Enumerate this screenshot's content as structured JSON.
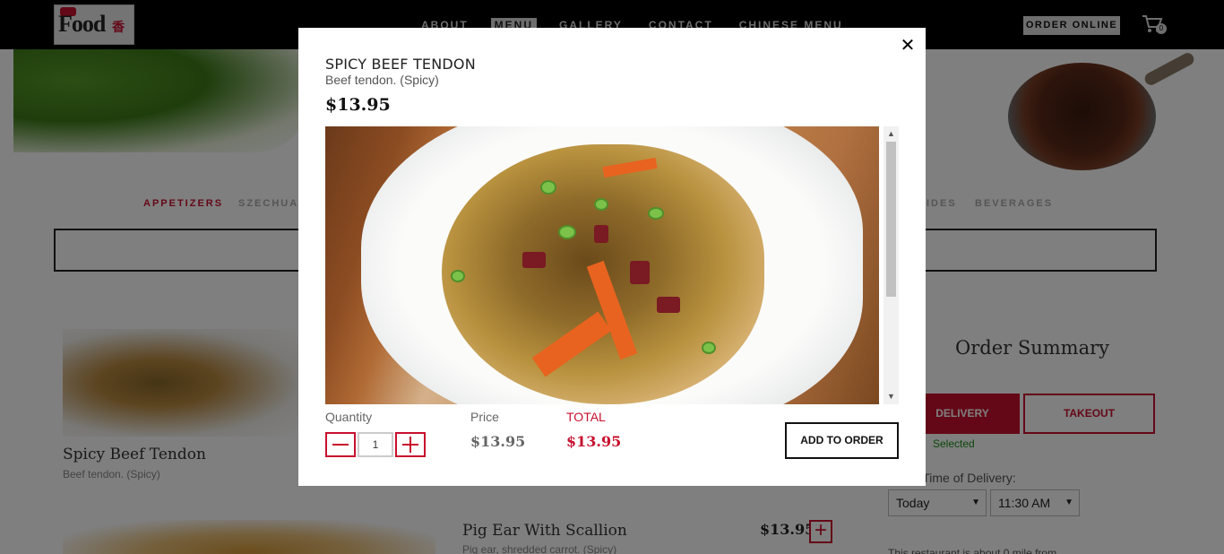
{
  "header": {
    "logo_text": "Food",
    "nav": [
      "ABOUT",
      "MENU",
      "GALLERY",
      "CONTACT",
      "CHINESE MENU"
    ],
    "active_nav": "MENU",
    "order_online": "ORDER ONLINE",
    "cart_count": "0"
  },
  "categories": {
    "appetizers": "APPETIZERS",
    "szechuan": "SZECHUA",
    "sides": "IDES",
    "beverages": "BEVERAGES",
    "active": "APPETIZERS"
  },
  "menu_items": [
    {
      "title": "Spicy Beef Tendon",
      "desc": "Beef tendon. (Spicy)"
    },
    {
      "title": "Pig Ear With Scallion",
      "desc": "Pig ear, shredded carrot. (Spicy)",
      "price": "$13.95"
    }
  ],
  "order_summary": {
    "title": "Order Summary",
    "delivery_label": "DELIVERY",
    "takeout_label": "TAKEOUT",
    "selected_note": "Selected",
    "delivery_time_label": "ed Time of Delivery:",
    "day": "Today",
    "time": "11:30 AM",
    "distance_note": "This restaurant is about 0 mile from"
  },
  "modal": {
    "title": "SPICY BEEF TENDON",
    "description": "Beef tendon. (Spicy)",
    "price": "$13.95",
    "close_glyph": "✕",
    "quantity_label": "Quantity",
    "quantity_value": "1",
    "price_label": "Price",
    "price_value": "$13.95",
    "total_label": "TOTAL",
    "total_value": "$13.95",
    "add_to_order": "ADD TO ORDER"
  },
  "colors": {
    "accent": "#c8102e",
    "header_bg": "#000000",
    "selected_green": "#1a8f1a"
  },
  "icons": {
    "cart": "cart-icon",
    "close": "close-icon",
    "minus": "minus-icon",
    "plus": "plus-icon"
  }
}
